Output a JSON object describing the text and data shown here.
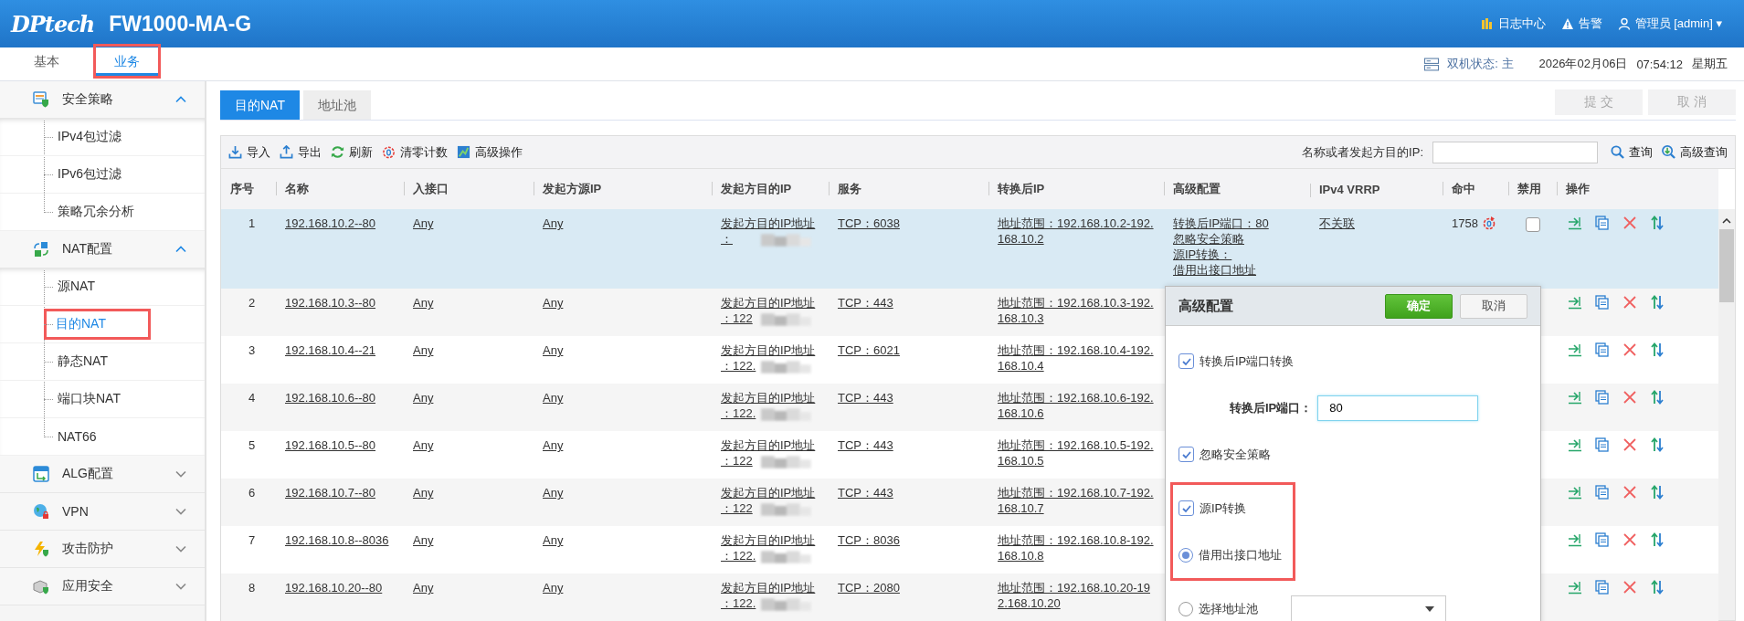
{
  "header": {
    "logo": "DPtech",
    "device": "FW1000-MA-G",
    "log_center": "日志中心",
    "alarm": "告警",
    "user": "管理员 [admin]",
    "user_caret": "▾"
  },
  "top_tabs": [
    {
      "label": "基本",
      "selected": false,
      "highlighted": false
    },
    {
      "label": "业务",
      "selected": true,
      "highlighted": true
    }
  ],
  "status": {
    "ha": "双机状态: 主",
    "date": "2026年02月06日",
    "time": "07:54:12",
    "weekday": "星期五"
  },
  "sidebar": [
    {
      "label": "安全策略",
      "expanded": true,
      "children": [
        {
          "label": "IPv4包过滤",
          "selected": false,
          "highlighted": false
        },
        {
          "label": "IPv6包过滤",
          "selected": false,
          "highlighted": false
        },
        {
          "label": "策略冗余分析",
          "selected": false,
          "highlighted": false
        }
      ]
    },
    {
      "label": "NAT配置",
      "expanded": true,
      "children": [
        {
          "label": "源NAT",
          "selected": false,
          "highlighted": false
        },
        {
          "label": "目的NAT",
          "selected": true,
          "highlighted": true
        },
        {
          "label": "静态NAT",
          "selected": false,
          "highlighted": false
        },
        {
          "label": "端口块NAT",
          "selected": false,
          "highlighted": false
        },
        {
          "label": "NAT66",
          "selected": false,
          "highlighted": false
        }
      ]
    },
    {
      "label": "ALG配置",
      "expanded": false
    },
    {
      "label": "VPN",
      "expanded": false
    },
    {
      "label": "攻击防护",
      "expanded": false
    },
    {
      "label": "应用安全",
      "expanded": false
    }
  ],
  "content_tabs": [
    {
      "label": "目的NAT",
      "selected": true
    },
    {
      "label": "地址池",
      "selected": false
    }
  ],
  "actions": [
    {
      "label": "提 交",
      "disabled": true
    },
    {
      "label": "取 消",
      "disabled": true
    }
  ],
  "toolbar": [
    "导入",
    "导出",
    "刷新",
    "清零计数",
    "高级操作"
  ],
  "search": {
    "label": "名称或者发起方目的IP:",
    "buttons": [
      "查询",
      "高级查询"
    ]
  },
  "table": {
    "columns": [
      "序号",
      "名称",
      "入接口",
      "发起方源IP",
      "发起方目的IP",
      "服务",
      "转换后IP",
      "高级配置",
      "IPv4 VRRP",
      "命中",
      "禁用",
      "操作"
    ],
    "rows": [
      {
        "no": "1",
        "name": "192.168.10.2--80",
        "in": "Any",
        "src": "Any",
        "dst": [
          "发起方目的IP地址",
          "："
        ],
        "service": "TCP：6038",
        "translated": [
          "地址范围：192.168.10.2-192.",
          "168.10.2"
        ],
        "advanced": [
          "转换后IP端口：80",
          "忽略安全策略",
          "源IP转换：",
          "借用出接口地址"
        ],
        "vrrp": "不关联",
        "hits": "1758",
        "disabled": false,
        "selected": true
      },
      {
        "no": "2",
        "name": "192.168.10.3--80",
        "in": "Any",
        "src": "Any",
        "dst": [
          "发起方目的IP地址",
          "：122"
        ],
        "service": "TCP：443",
        "translated": [
          "地址范围：192.168.10.3-192.",
          "168.10.3"
        ],
        "selected": false
      },
      {
        "no": "3",
        "name": "192.168.10.4--21",
        "in": "Any",
        "src": "Any",
        "dst": [
          "发起方目的IP地址",
          "：122."
        ],
        "service": "TCP：6021",
        "translated": [
          "地址范围：192.168.10.4-192.",
          "168.10.4"
        ],
        "selected": false
      },
      {
        "no": "4",
        "name": "192.168.10.6--80",
        "in": "Any",
        "src": "Any",
        "dst": [
          "发起方目的IP地址",
          "：122."
        ],
        "service": "TCP：443",
        "translated": [
          "地址范围：192.168.10.6-192.",
          "168.10.6"
        ],
        "selected": false
      },
      {
        "no": "5",
        "name": "192.168.10.5--80",
        "in": "Any",
        "src": "Any",
        "dst": [
          "发起方目的IP地址",
          "：122"
        ],
        "service": "TCP：443",
        "translated": [
          "地址范围：192.168.10.5-192.",
          "168.10.5"
        ],
        "selected": false
      },
      {
        "no": "6",
        "name": "192.168.10.7--80",
        "in": "Any",
        "src": "Any",
        "dst": [
          "发起方目的IP地址",
          "：122"
        ],
        "service": "TCP：443",
        "translated": [
          "地址范围：192.168.10.7-192.",
          "168.10.7"
        ],
        "selected": false
      },
      {
        "no": "7",
        "name": "192.168.10.8--8036",
        "in": "Any",
        "src": "Any",
        "dst": [
          "发起方目的IP地址",
          "：122."
        ],
        "service": "TCP：8036",
        "translated": [
          "地址范围：192.168.10.8-192.",
          "168.10.8"
        ],
        "selected": false
      },
      {
        "no": "8",
        "name": "192.168.10.20--80",
        "in": "Any",
        "src": "Any",
        "dst": [
          "发起方目的IP地址",
          "：122."
        ],
        "service": "TCP：2080",
        "translated": [
          "地址范围：192.168.10.20-19",
          "2.168.10.20"
        ],
        "selected": false
      }
    ]
  },
  "popup": {
    "title": "高级配置",
    "confirm": "确定",
    "cancel": "取消",
    "sections": [
      {
        "highlighted": false,
        "items": [
          {
            "kind": "checkbox",
            "label": "转换后IP端口转换",
            "checked": true
          },
          {
            "kind": "field",
            "label": "转换后IP端口：",
            "value": "80"
          },
          {
            "kind": "checkbox",
            "label": "忽略安全策略",
            "checked": true
          }
        ]
      },
      {
        "highlighted": true,
        "items": [
          {
            "kind": "checkbox",
            "label": "源IP转换",
            "checked": true
          },
          {
            "kind": "radio",
            "label": "借用出接口地址",
            "selected": true
          }
        ]
      },
      {
        "highlighted": false,
        "items": [
          {
            "kind": "radio_select",
            "label": "选择地址池",
            "selected": false
          }
        ]
      }
    ]
  }
}
